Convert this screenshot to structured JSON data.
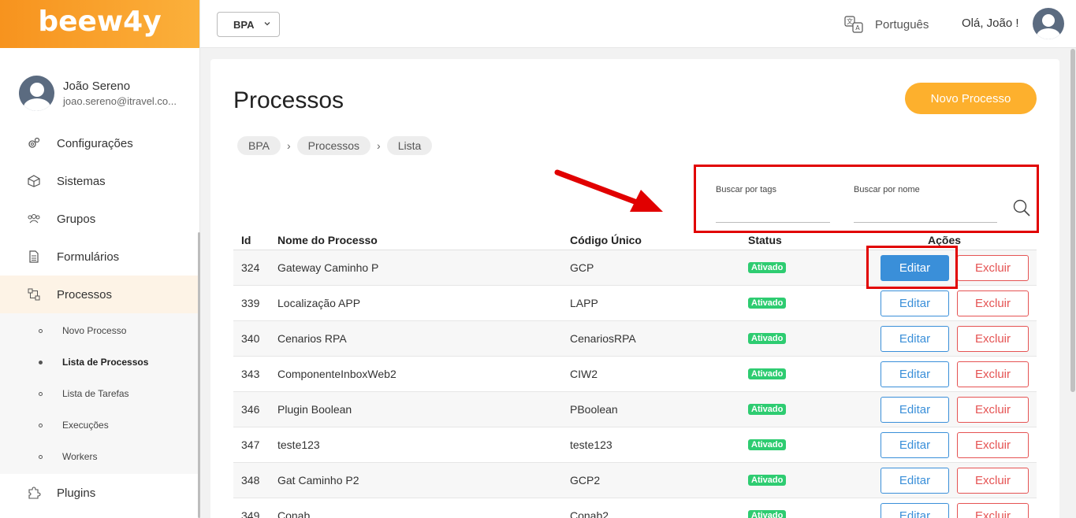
{
  "brand": {
    "logo": "beew4y",
    "colors": {
      "orange": "#f7931e",
      "accent_yellow": "#fdb02d",
      "blue": "#3a8fd9",
      "red": "#e55353",
      "green": "#2ecc71"
    }
  },
  "user": {
    "name": "João Sereno",
    "email": "joao.sereno@itravel.co..."
  },
  "sidebar": {
    "items": [
      {
        "label": "Configurações",
        "icon": "gears-icon"
      },
      {
        "label": "Sistemas",
        "icon": "cube-icon"
      },
      {
        "label": "Grupos",
        "icon": "users-icon"
      },
      {
        "label": "Formulários",
        "icon": "document-icon"
      },
      {
        "label": "Processos",
        "icon": "flow-icon"
      }
    ],
    "subitems": [
      "Novo Processo",
      "Lista de Processos",
      "Lista de Tarefas",
      "Execuções",
      "Workers"
    ],
    "bottom_item": {
      "label": "Plugins",
      "icon": "puzzle-icon"
    }
  },
  "topbar": {
    "selector": "BPA",
    "language": "Português",
    "greeting": "Olá, João !"
  },
  "page": {
    "title": "Processos",
    "new_button": "Novo Processo",
    "breadcrumb": [
      "BPA",
      "Processos",
      "Lista"
    ],
    "filters": {
      "tags_label": "Buscar por tags",
      "name_label": "Buscar por nome"
    }
  },
  "table": {
    "headers": {
      "id": "Id",
      "name": "Nome do Processo",
      "code": "Código Único",
      "status": "Status",
      "actions": "Ações"
    },
    "edit_label": "Editar",
    "delete_label": "Excluir",
    "rows": [
      {
        "id": "324",
        "name": "Gateway Caminho P",
        "code": "GCP",
        "status": "Ativado"
      },
      {
        "id": "339",
        "name": "Localização APP",
        "code": "LAPP",
        "status": "Ativado"
      },
      {
        "id": "340",
        "name": "Cenarios RPA",
        "code": "CenariosRPA",
        "status": "Ativado"
      },
      {
        "id": "343",
        "name": "ComponenteInboxWeb2",
        "code": "CIW2",
        "status": "Ativado"
      },
      {
        "id": "346",
        "name": "Plugin Boolean",
        "code": "PBoolean",
        "status": "Ativado"
      },
      {
        "id": "347",
        "name": "teste123",
        "code": "teste123",
        "status": "Ativado"
      },
      {
        "id": "348",
        "name": "Gat Caminho P2",
        "code": "GCP2",
        "status": "Ativado"
      },
      {
        "id": "349",
        "name": "Conab",
        "code": "Conab2",
        "status": "Ativado"
      }
    ]
  }
}
